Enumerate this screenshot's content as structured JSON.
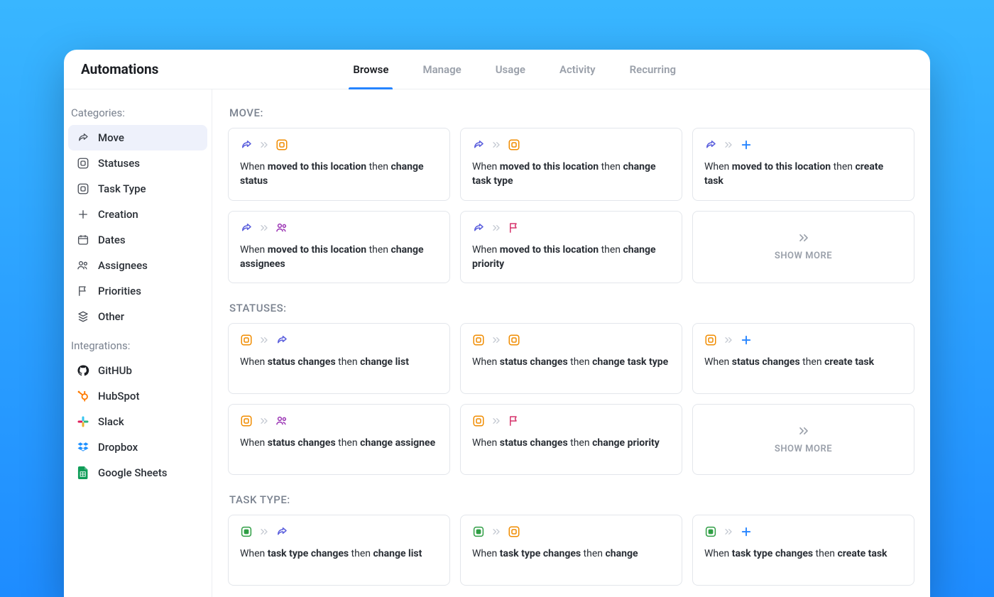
{
  "header": {
    "title": "Automations"
  },
  "tabs": [
    {
      "label": "Browse",
      "active": true
    },
    {
      "label": "Manage",
      "active": false
    },
    {
      "label": "Usage",
      "active": false
    },
    {
      "label": "Activity",
      "active": false
    },
    {
      "label": "Recurring",
      "active": false
    }
  ],
  "sidebar": {
    "categories_heading": "Categories:",
    "integrations_heading": "Integrations:",
    "categories": [
      {
        "id": "move",
        "label": "Move",
        "icon": "share",
        "active": true
      },
      {
        "id": "statuses",
        "label": "Statuses",
        "icon": "status"
      },
      {
        "id": "task-type",
        "label": "Task Type",
        "icon": "status"
      },
      {
        "id": "creation",
        "label": "Creation",
        "icon": "plus"
      },
      {
        "id": "dates",
        "label": "Dates",
        "icon": "calendar"
      },
      {
        "id": "assignees",
        "label": "Assignees",
        "icon": "people"
      },
      {
        "id": "priorities",
        "label": "Priorities",
        "icon": "flag"
      },
      {
        "id": "other",
        "label": "Other",
        "icon": "stack"
      }
    ],
    "integrations": [
      {
        "id": "github",
        "label": "GitHUb",
        "icon": "github"
      },
      {
        "id": "hubspot",
        "label": "HubSpot",
        "icon": "hubspot"
      },
      {
        "id": "slack",
        "label": "Slack",
        "icon": "slack"
      },
      {
        "id": "dropbox",
        "label": "Dropbox",
        "icon": "dropbox"
      },
      {
        "id": "gsheets",
        "label": "Google Sheets",
        "icon": "gsheets"
      }
    ]
  },
  "sections": [
    {
      "title": "MOVE:",
      "cards": [
        {
          "icons": [
            "share",
            "status"
          ],
          "text": [
            [
              "When ",
              "light"
            ],
            [
              "moved to this location",
              "bold"
            ],
            [
              " then ",
              "light"
            ],
            [
              "change status",
              "bold"
            ]
          ]
        },
        {
          "icons": [
            "share",
            "status"
          ],
          "text": [
            [
              "When ",
              "light"
            ],
            [
              "moved to this location",
              "bold"
            ],
            [
              " then ",
              "light"
            ],
            [
              "change task type",
              "bold"
            ]
          ]
        },
        {
          "icons": [
            "share",
            "plus"
          ],
          "text": [
            [
              "When ",
              "light"
            ],
            [
              "moved to this location",
              "bold"
            ],
            [
              " then ",
              "light"
            ],
            [
              "create task",
              "bold"
            ]
          ]
        },
        {
          "icons": [
            "share",
            "people"
          ],
          "text": [
            [
              "When ",
              "light"
            ],
            [
              "moved to this location",
              "bold"
            ],
            [
              " then ",
              "light"
            ],
            [
              "change assignees",
              "bold"
            ]
          ]
        },
        {
          "icons": [
            "share",
            "flag"
          ],
          "text": [
            [
              "When ",
              "light"
            ],
            [
              "moved to this location",
              "bold"
            ],
            [
              " then ",
              "light"
            ],
            [
              "change priority",
              "bold"
            ]
          ]
        },
        {
          "show_more": true,
          "label": "SHOW MORE"
        }
      ]
    },
    {
      "title": "STATUSES:",
      "cards": [
        {
          "icons": [
            "status",
            "share"
          ],
          "text": [
            [
              "When ",
              "light"
            ],
            [
              "status changes",
              "bold"
            ],
            [
              " then ",
              "light"
            ],
            [
              "change list",
              "bold"
            ]
          ]
        },
        {
          "icons": [
            "status",
            "status"
          ],
          "text": [
            [
              "When ",
              "light"
            ],
            [
              "status changes",
              "bold"
            ],
            [
              " then ",
              "light"
            ],
            [
              "change task type",
              "bold"
            ]
          ]
        },
        {
          "icons": [
            "status",
            "plus"
          ],
          "text": [
            [
              "When ",
              "light"
            ],
            [
              "status changes",
              "bold"
            ],
            [
              " then ",
              "light"
            ],
            [
              "create task",
              "bold"
            ]
          ]
        },
        {
          "icons": [
            "status",
            "people"
          ],
          "text": [
            [
              "When ",
              "light"
            ],
            [
              "status changes",
              "bold"
            ],
            [
              " then ",
              "light"
            ],
            [
              "change assignee",
              "bold"
            ]
          ]
        },
        {
          "icons": [
            "status",
            "flag"
          ],
          "text": [
            [
              "When ",
              "light"
            ],
            [
              "status changes",
              "bold"
            ],
            [
              " then ",
              "light"
            ],
            [
              "change priority",
              "bold"
            ]
          ]
        },
        {
          "show_more": true,
          "label": "SHOW MORE"
        }
      ]
    },
    {
      "title": "TASK TYPE:",
      "cards": [
        {
          "icons": [
            "task",
            "share"
          ],
          "text": [
            [
              "When ",
              "light"
            ],
            [
              "task type changes",
              "bold"
            ],
            [
              " then ",
              "light"
            ],
            [
              "change list",
              "bold"
            ]
          ]
        },
        {
          "icons": [
            "task",
            "status"
          ],
          "text": [
            [
              "When ",
              "light"
            ],
            [
              "task type changes",
              "bold"
            ],
            [
              " then ",
              "light"
            ],
            [
              "change",
              "bold"
            ]
          ]
        },
        {
          "icons": [
            "task",
            "plus"
          ],
          "text": [
            [
              "When ",
              "light"
            ],
            [
              "task type changes",
              "bold"
            ],
            [
              " then ",
              "light"
            ],
            [
              "create task",
              "bold"
            ]
          ]
        }
      ]
    }
  ]
}
